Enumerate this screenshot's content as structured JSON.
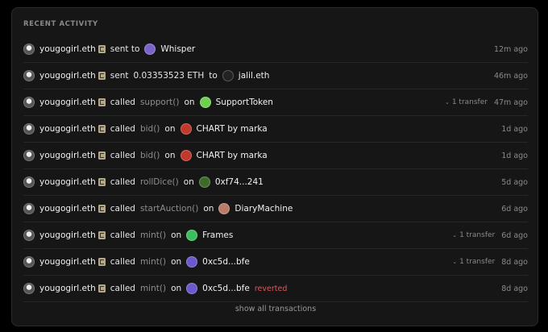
{
  "header": {
    "title": "RECENT ACTIVITY"
  },
  "rows": [
    {
      "user": "yougogirl.eth",
      "verb": "sent to",
      "fn": "",
      "amount": "",
      "on": "",
      "target": "Whisper",
      "target_icon": "whisper-icon",
      "icon_color": "#7b63c9",
      "transfer": "",
      "reverted": "",
      "time": "12m ago"
    },
    {
      "user": "yougogirl.eth",
      "verb": "sent",
      "fn": "",
      "amount": "0.03353523 ETH",
      "on": "to",
      "target": "jalil.eth",
      "target_icon": "jalil-avatar-icon",
      "icon_color": "#222222",
      "transfer": "",
      "reverted": "",
      "time": "46m ago"
    },
    {
      "user": "yougogirl.eth",
      "verb": "called",
      "fn": "support()",
      "amount": "",
      "on": "on",
      "target": "SupportToken",
      "target_icon": "supporttoken-icon",
      "icon_color": "#6fcf4f",
      "transfer": "1 transfer",
      "reverted": "",
      "time": "47m ago"
    },
    {
      "user": "yougogirl.eth",
      "verb": "called",
      "fn": "bid()",
      "amount": "",
      "on": "on",
      "target": "CHART by marka",
      "target_icon": "chart-icon",
      "icon_color": "#c0392b",
      "transfer": "",
      "reverted": "",
      "time": "1d ago"
    },
    {
      "user": "yougogirl.eth",
      "verb": "called",
      "fn": "bid()",
      "amount": "",
      "on": "on",
      "target": "CHART by marka",
      "target_icon": "chart-icon",
      "icon_color": "#c0392b",
      "transfer": "",
      "reverted": "",
      "time": "1d ago"
    },
    {
      "user": "yougogirl.eth",
      "verb": "called",
      "fn": "rollDice()",
      "amount": "",
      "on": "on",
      "target": "0xf74...241",
      "target_icon": "dice-contract-icon",
      "icon_color": "#3c6b2a",
      "transfer": "",
      "reverted": "",
      "time": "5d ago"
    },
    {
      "user": "yougogirl.eth",
      "verb": "called",
      "fn": "startAuction()",
      "amount": "",
      "on": "on",
      "target": "DiaryMachine",
      "target_icon": "diarymachine-icon",
      "icon_color": "#b87c6a",
      "transfer": "",
      "reverted": "",
      "time": "6d ago"
    },
    {
      "user": "yougogirl.eth",
      "verb": "called",
      "fn": "mint()",
      "amount": "",
      "on": "on",
      "target": "Frames",
      "target_icon": "frames-icon",
      "icon_color": "#3bbf5c",
      "transfer": "1 transfer",
      "reverted": "",
      "time": "6d ago"
    },
    {
      "user": "yougogirl.eth",
      "verb": "called",
      "fn": "mint()",
      "amount": "",
      "on": "on",
      "target": "0xc5d...bfe",
      "target_icon": "contract-icon",
      "icon_color": "#6a5acd",
      "transfer": "1 transfer",
      "reverted": "",
      "time": "8d ago"
    },
    {
      "user": "yougogirl.eth",
      "verb": "called",
      "fn": "mint()",
      "amount": "",
      "on": "on",
      "target": "0xc5d...bfe",
      "target_icon": "contract-icon",
      "icon_color": "#6a5acd",
      "transfer": "",
      "reverted": "reverted",
      "time": "8d ago"
    }
  ],
  "footer": {
    "show_all": "show all transactions"
  },
  "colors": {
    "background": "#161616",
    "muted": "#8a8a8a",
    "reverted": "#e0565b"
  }
}
